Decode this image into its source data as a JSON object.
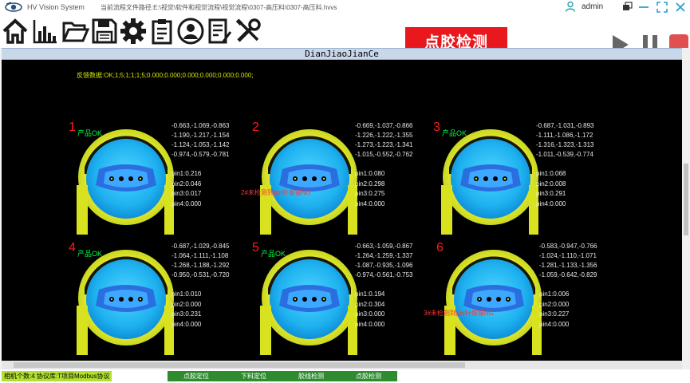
{
  "titlebar": {
    "app_name": "HV Vision System",
    "path": "当前流程文件路径:E:\\视觉\\软件和视觉流程\\视觉流程\\0307-高压料\\0307-高压料.hvvs",
    "user": "admin"
  },
  "toolbar": {
    "icons": [
      "home-icon",
      "chart-icon",
      "folder-icon",
      "save-icon",
      "settings-icon",
      "checklist-icon",
      "user-icon",
      "report-icon",
      "tools-icon"
    ],
    "banner": "点胶检测",
    "run_icons": [
      "play-icon",
      "pause-icon",
      "stop-icon"
    ],
    "colors": {
      "banner_bg": "#e8181c",
      "stop_btn": "#e05050",
      "play_btn": "#666666"
    }
  },
  "viewer": {
    "header": "DianJiaoJianCe",
    "feedback": "反馈数据:OK;1;5;1;1;1;5;0.000;0.000;0.000;0.000;0.000;0.000;"
  },
  "cells": [
    {
      "num": "1",
      "status": "产品OK",
      "metrics": [
        "-0.663,-1.069,-0.863",
        "-1.190,-1.217,-1.154",
        "-1.124,-1.053,-1.142",
        "-0.974,-0.579,-0.781"
      ],
      "pins": [
        "pin1:0.216",
        "pin2:0.046",
        "pin3:0.017",
        "pin4:0.000"
      ],
      "error": ""
    },
    {
      "num": "2",
      "status": "",
      "metrics": [
        "-0.669,-1.037,-0.866",
        "-1.226,-1.222,-1.355",
        "-1.273,-1.223,-1.341",
        "-1.015,-0.552,-0.762"
      ],
      "pins": [
        "pin1:0.080",
        "pin2:0.298",
        "pin3:0.275",
        "pin4:0.000"
      ],
      "error": "2#未检测到pin针搭锡NG"
    },
    {
      "num": "3",
      "status": "产品OK",
      "metrics": [
        "-0.687,-1.031,-0.893",
        "-1.111,-1.086,-1.172",
        "-1.316,-1.323,-1.313",
        "-1.011,-0.539,-0.774"
      ],
      "pins": [
        "pin1:0.068",
        "pin2:0.008",
        "pin3:0.291",
        "pin4:0.000"
      ],
      "error": ""
    },
    {
      "num": "4",
      "status": "产品OK",
      "metrics": [
        "-0.687,-1.029,-0.845",
        "-1.064,-1.111,-1.108",
        "-1.268,-1.188,-1.292",
        "-0.950,-0.531,-0.720"
      ],
      "pins": [
        "pin1:0.010",
        "pin2:0.000",
        "pin3:0.231",
        "pin4:0.000"
      ],
      "error": ""
    },
    {
      "num": "5",
      "status": "产品OK",
      "metrics": [
        "-0.663,-1.059,-0.867",
        "-1.264,-1.259,-1.337",
        "-1.087,-0.935,-1.096",
        "-0.974,-0.561,-0.753"
      ],
      "pins": [
        "pin1:0.194",
        "pin2:0.304",
        "pin3:0.000",
        "pin4:0.000"
      ],
      "error": ""
    },
    {
      "num": "6",
      "status": "",
      "metrics": [
        "-0.583,-0.947,-0.766",
        "-1.024,-1.110,-1.071",
        "-1.281,-1.133,-1.356",
        "-1.059,-0.642,-0.829"
      ],
      "pins": [
        "pin1:0.006",
        "pin2:0.000",
        "pin3:0.227",
        "pin4:0.000"
      ],
      "error": "3#未检测到pin针搭锡NG"
    }
  ],
  "statusbar": {
    "info": "相机个数:4 协议库:T项目Modbus协议",
    "buttons": [
      "点胶定位",
      "下料定位",
      "胶线检测",
      "点胶检测"
    ]
  }
}
